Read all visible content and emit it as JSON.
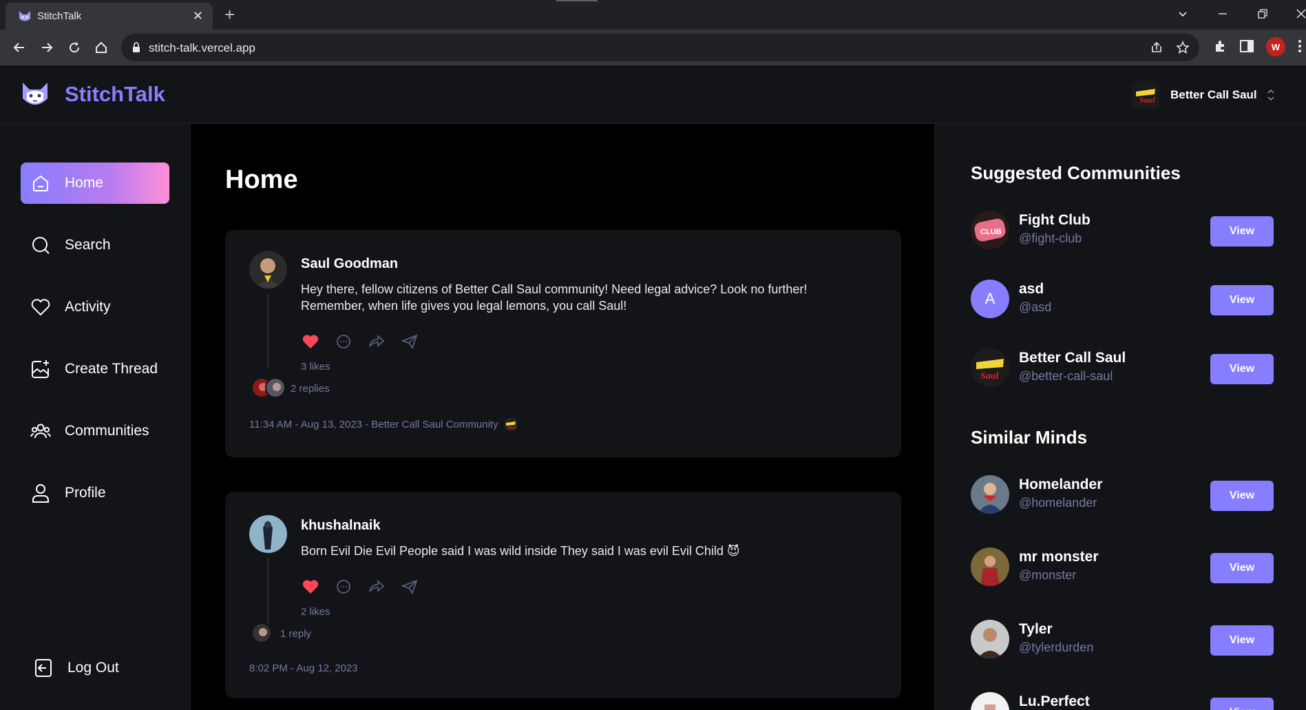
{
  "browser": {
    "tab_title": "StitchTalk",
    "tab_close": "✕",
    "new_tab": "+",
    "url": "stitch-talk.vercel.app",
    "profile_initial": "W"
  },
  "app": {
    "brand": "StitchTalk",
    "active_community": "Better Call Saul",
    "accent_color": "#877eff"
  },
  "nav": {
    "items": [
      {
        "label": "Home",
        "icon": "home-icon",
        "active": true
      },
      {
        "label": "Search",
        "icon": "search-icon"
      },
      {
        "label": "Activity",
        "icon": "heart-icon"
      },
      {
        "label": "Create Thread",
        "icon": "create-thread-icon"
      },
      {
        "label": "Communities",
        "icon": "communities-icon"
      },
      {
        "label": "Profile",
        "icon": "user-icon"
      }
    ],
    "logout": "Log Out"
  },
  "main": {
    "title": "Home",
    "threads": [
      {
        "author": "Saul Goodman",
        "content": "Hey there, fellow citizens of Better Call Saul community! Need legal advice? Look no further! Remember, when life gives you legal lemons, you call Saul!",
        "likes": "3 likes",
        "replies": "2 replies",
        "meta": "11:34 AM - Aug 13, 2023 - Better Call Saul Community"
      },
      {
        "author": "khushalnaik",
        "content": "Born Evil Die Evil People said I was wild inside They said I was evil Evil Child 😈",
        "likes": "2 likes",
        "replies": "1 reply",
        "meta": "8:02 PM - Aug 12, 2023"
      }
    ]
  },
  "right": {
    "communities_title": "Suggested Communities",
    "communities": [
      {
        "name": "Fight Club",
        "handle": "@fight-club",
        "button": "View"
      },
      {
        "name": "asd",
        "handle": "@asd",
        "button": "View",
        "initial": "A"
      },
      {
        "name": "Better Call Saul",
        "handle": "@better-call-saul",
        "button": "View"
      }
    ],
    "users_title": "Similar Minds",
    "users": [
      {
        "name": "Homelander",
        "handle": "@homelander",
        "button": "View"
      },
      {
        "name": "mr monster",
        "handle": "@monster",
        "button": "View"
      },
      {
        "name": "Tyler",
        "handle": "@tylerdurden",
        "button": "View"
      },
      {
        "name": "Lu.Perfect",
        "handle": "",
        "button": "View"
      }
    ]
  }
}
